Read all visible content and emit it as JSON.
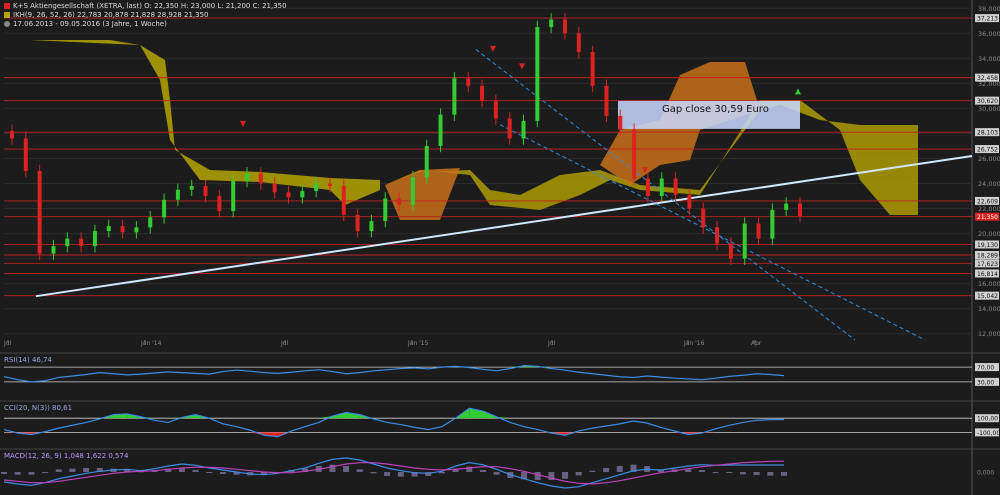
{
  "header": {
    "line1": "K+S Aktiengesellschaft (XETRA, last) O: 22,350  H: 23,000  L: 21,200  C: 21,350",
    "line2": "IKH(9, 26, 52, 26)  22,783  20,878  21,828  28,928  21,350",
    "line3": "17.06.2013 - 09.05.2016 (3 Jahre, 1 Woche)"
  },
  "colors": {
    "background": "#1c1c1c",
    "bull": "#33cc33",
    "bear": "#dd2222",
    "cloud_bull": "#b5a400",
    "cloud_bear": "#c8701a",
    "trendline": "#cfe8ff",
    "channel": "#2e8fe0",
    "hline": "#c02020",
    "gap_box": "#c9d8ff"
  },
  "chart_data": [
    {
      "type": "candlestick",
      "title": "K+S Aktiengesellschaft (XETRA, last)",
      "x_ticks": [
        "Jul",
        "Jan '14",
        "Jul",
        "Jan '15",
        "Jul",
        "Jan '16",
        "Apr"
      ],
      "y_ticks": [
        "12,000",
        "14,000",
        "16,000",
        "18,000",
        "20,000",
        "22,000",
        "24,000",
        "26,000",
        "28,000",
        "30,000",
        "32,000",
        "34,000",
        "36,000",
        "38,000"
      ],
      "ylim": [
        11.5,
        38.5
      ],
      "horizontal_levels": [
        "37,213",
        "32,458",
        "30,620",
        "28,103",
        "26,752",
        "22,609",
        "21,350",
        "19,130",
        "18,289",
        "17,623",
        "16,814",
        "15,042"
      ],
      "annotation": "Gap close 30,59 Euro",
      "closes": [
        27.6,
        25.0,
        18.4,
        19.0,
        19.6,
        19.0,
        20.2,
        20.6,
        20.1,
        20.5,
        21.3,
        22.7,
        23.5,
        23.8,
        23.0,
        21.8,
        24.2,
        24.8,
        24.0,
        23.3,
        22.9,
        23.4,
        24.0,
        23.8,
        21.5,
        20.2,
        21.0,
        22.8,
        22.3,
        24.5,
        27.0,
        29.5,
        32.4,
        31.8,
        30.6,
        29.2,
        27.6,
        29.0,
        36.5,
        37.1,
        36.0,
        34.5,
        31.8,
        29.4,
        28.3,
        24.4,
        23.0,
        24.4,
        23.1,
        22.0,
        20.5,
        19.2,
        18.0,
        20.8,
        19.6,
        21.9,
        22.4,
        21.4
      ]
    },
    {
      "type": "line",
      "title": "RSI(14)",
      "value_label": "46,74",
      "levels": [
        "70,00",
        "30,00"
      ],
      "ylim": [
        0,
        100
      ],
      "values": [
        44,
        36,
        30,
        33,
        42,
        46,
        50,
        55,
        52,
        49,
        51,
        54,
        57,
        55,
        53,
        51,
        58,
        62,
        59,
        55,
        53,
        56,
        60,
        63,
        58,
        52,
        55,
        60,
        63,
        66,
        68,
        65,
        70,
        72,
        69,
        64,
        60,
        66,
        74,
        72,
        66,
        62,
        56,
        52,
        48,
        44,
        42,
        46,
        43,
        40,
        38,
        36,
        40,
        45,
        48,
        52,
        50,
        47
      ]
    },
    {
      "type": "line",
      "title": "CCI(20, N(3))",
      "value_label": "80,61",
      "levels": [
        "100,00",
        "-100,00"
      ],
      "ylim": [
        -250,
        300
      ],
      "values": [
        -60,
        -110,
        -130,
        -90,
        -40,
        0,
        40,
        90,
        150,
        160,
        120,
        70,
        40,
        110,
        150,
        100,
        20,
        -20,
        -70,
        -140,
        -160,
        -80,
        -20,
        40,
        130,
        180,
        150,
        90,
        40,
        10,
        -30,
        -60,
        -20,
        100,
        240,
        200,
        120,
        40,
        -20,
        -60,
        -110,
        -140,
        -80,
        -40,
        -10,
        20,
        60,
        30,
        -30,
        -80,
        -130,
        -110,
        -50,
        0,
        40,
        70,
        80,
        81
      ]
    },
    {
      "type": "line",
      "title": "MACD(12, 26, 9)",
      "value_label": "1,048  1,622  0,574",
      "levels": [
        "0,000"
      ],
      "ylim": [
        -3,
        3
      ],
      "macd": [
        -1.5,
        -1.8,
        -2.0,
        -1.6,
        -1.0,
        -0.6,
        -0.2,
        0.1,
        0.3,
        0.4,
        0.2,
        0.5,
        0.9,
        1.2,
        1.0,
        0.6,
        0.3,
        0.0,
        -0.3,
        -0.4,
        -0.2,
        0.2,
        0.6,
        1.3,
        1.9,
        2.1,
        1.8,
        1.2,
        0.6,
        0.2,
        -0.1,
        -0.2,
        0.1,
        0.9,
        1.4,
        1.1,
        0.4,
        -0.4,
        -1.0,
        -1.6,
        -2.1,
        -2.4,
        -2.2,
        -1.6,
        -1.0,
        -0.4,
        0.2,
        0.4,
        0.3,
        0.6,
        0.9,
        1.1,
        1.0,
        1.05,
        1.048,
        1.048,
        1.05,
        1.048
      ],
      "signal": [
        -1.2,
        -1.4,
        -1.6,
        -1.6,
        -1.4,
        -1.1,
        -0.8,
        -0.5,
        -0.2,
        0.0,
        0.1,
        0.2,
        0.4,
        0.6,
        0.7,
        0.7,
        0.6,
        0.4,
        0.2,
        0.0,
        -0.1,
        -0.1,
        0.1,
        0.4,
        0.8,
        1.2,
        1.4,
        1.4,
        1.2,
        0.9,
        0.6,
        0.4,
        0.3,
        0.4,
        0.6,
        0.8,
        0.8,
        0.5,
        0.1,
        -0.4,
        -0.9,
        -1.4,
        -1.7,
        -1.8,
        -1.6,
        -1.3,
        -0.9,
        -0.5,
        -0.1,
        0.2,
        0.5,
        0.8,
        1.0,
        1.2,
        1.4,
        1.5,
        1.6,
        1.622
      ]
    }
  ]
}
